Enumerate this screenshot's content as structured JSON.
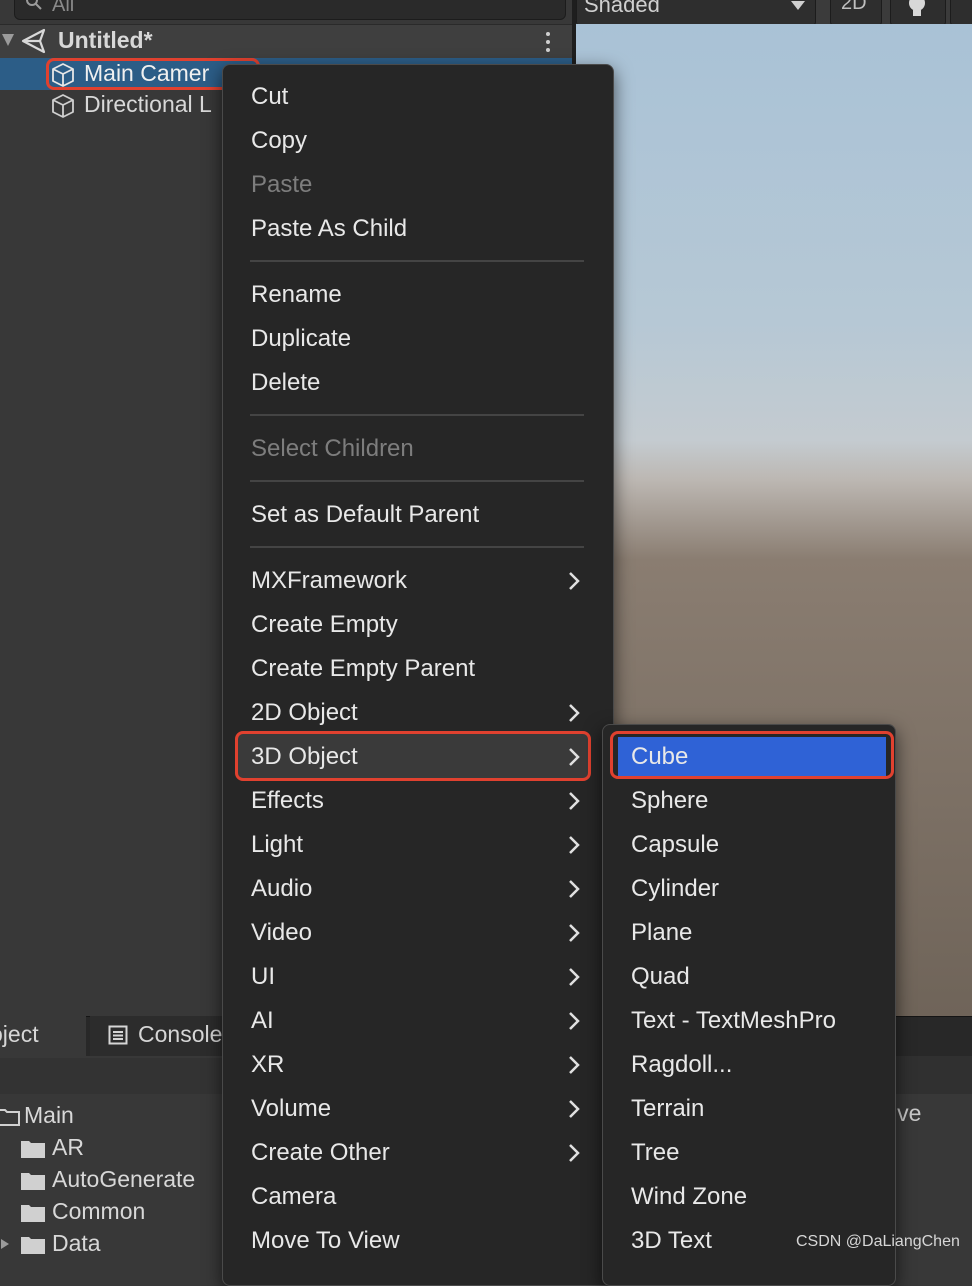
{
  "hierarchy": {
    "search_placeholder": "All",
    "scene_name": "Untitled*",
    "items": [
      {
        "label": "Main Camer",
        "selected": true
      },
      {
        "label": "Directional L",
        "selected": false
      }
    ]
  },
  "scene_toolbar": {
    "shading_mode": "Shaded",
    "toggle_2d": "2D"
  },
  "bottom_panel": {
    "tabs": [
      "oject",
      "Console"
    ],
    "right_label": "ive",
    "folders": [
      {
        "label": "Main",
        "expanded": true
      },
      {
        "label": "AR"
      },
      {
        "label": "AutoGenerate"
      },
      {
        "label": "Common"
      },
      {
        "label": "Data",
        "expanded": false
      }
    ]
  },
  "context_menu": {
    "items": [
      {
        "label": "Cut"
      },
      {
        "label": "Copy"
      },
      {
        "label": "Paste",
        "disabled": true
      },
      {
        "label": "Paste As Child"
      },
      {
        "label": "Rename"
      },
      {
        "label": "Duplicate"
      },
      {
        "label": "Delete"
      },
      {
        "label": "Select Children",
        "disabled": true
      },
      {
        "label": "Set as Default Parent"
      },
      {
        "label": "MXFramework",
        "submenu": true
      },
      {
        "label": "Create Empty"
      },
      {
        "label": "Create Empty Parent"
      },
      {
        "label": "2D Object",
        "submenu": true
      },
      {
        "label": "3D Object",
        "submenu": true,
        "active": true
      },
      {
        "label": "Effects",
        "submenu": true
      },
      {
        "label": "Light",
        "submenu": true
      },
      {
        "label": "Audio",
        "submenu": true
      },
      {
        "label": "Video",
        "submenu": true
      },
      {
        "label": "UI",
        "submenu": true
      },
      {
        "label": "AI",
        "submenu": true
      },
      {
        "label": "XR",
        "submenu": true
      },
      {
        "label": "Volume",
        "submenu": true
      },
      {
        "label": "Create Other",
        "submenu": true
      },
      {
        "label": "Camera"
      },
      {
        "label": "Move To View"
      }
    ]
  },
  "submenu_3d_object": {
    "items": [
      {
        "label": "Cube",
        "highlighted": true
      },
      {
        "label": "Sphere"
      },
      {
        "label": "Capsule"
      },
      {
        "label": "Cylinder"
      },
      {
        "label": "Plane"
      },
      {
        "label": "Quad"
      },
      {
        "label": "Text - TextMeshPro"
      },
      {
        "label": "Ragdoll..."
      },
      {
        "label": "Terrain"
      },
      {
        "label": "Tree"
      },
      {
        "label": "Wind Zone"
      },
      {
        "label": "3D Text"
      }
    ]
  },
  "watermark": "CSDN @DaLiangChen",
  "colors": {
    "selection_blue": "#2f62d6",
    "annotation_red": "#e0412f",
    "hierarchy_selected": "#2c5d87"
  }
}
